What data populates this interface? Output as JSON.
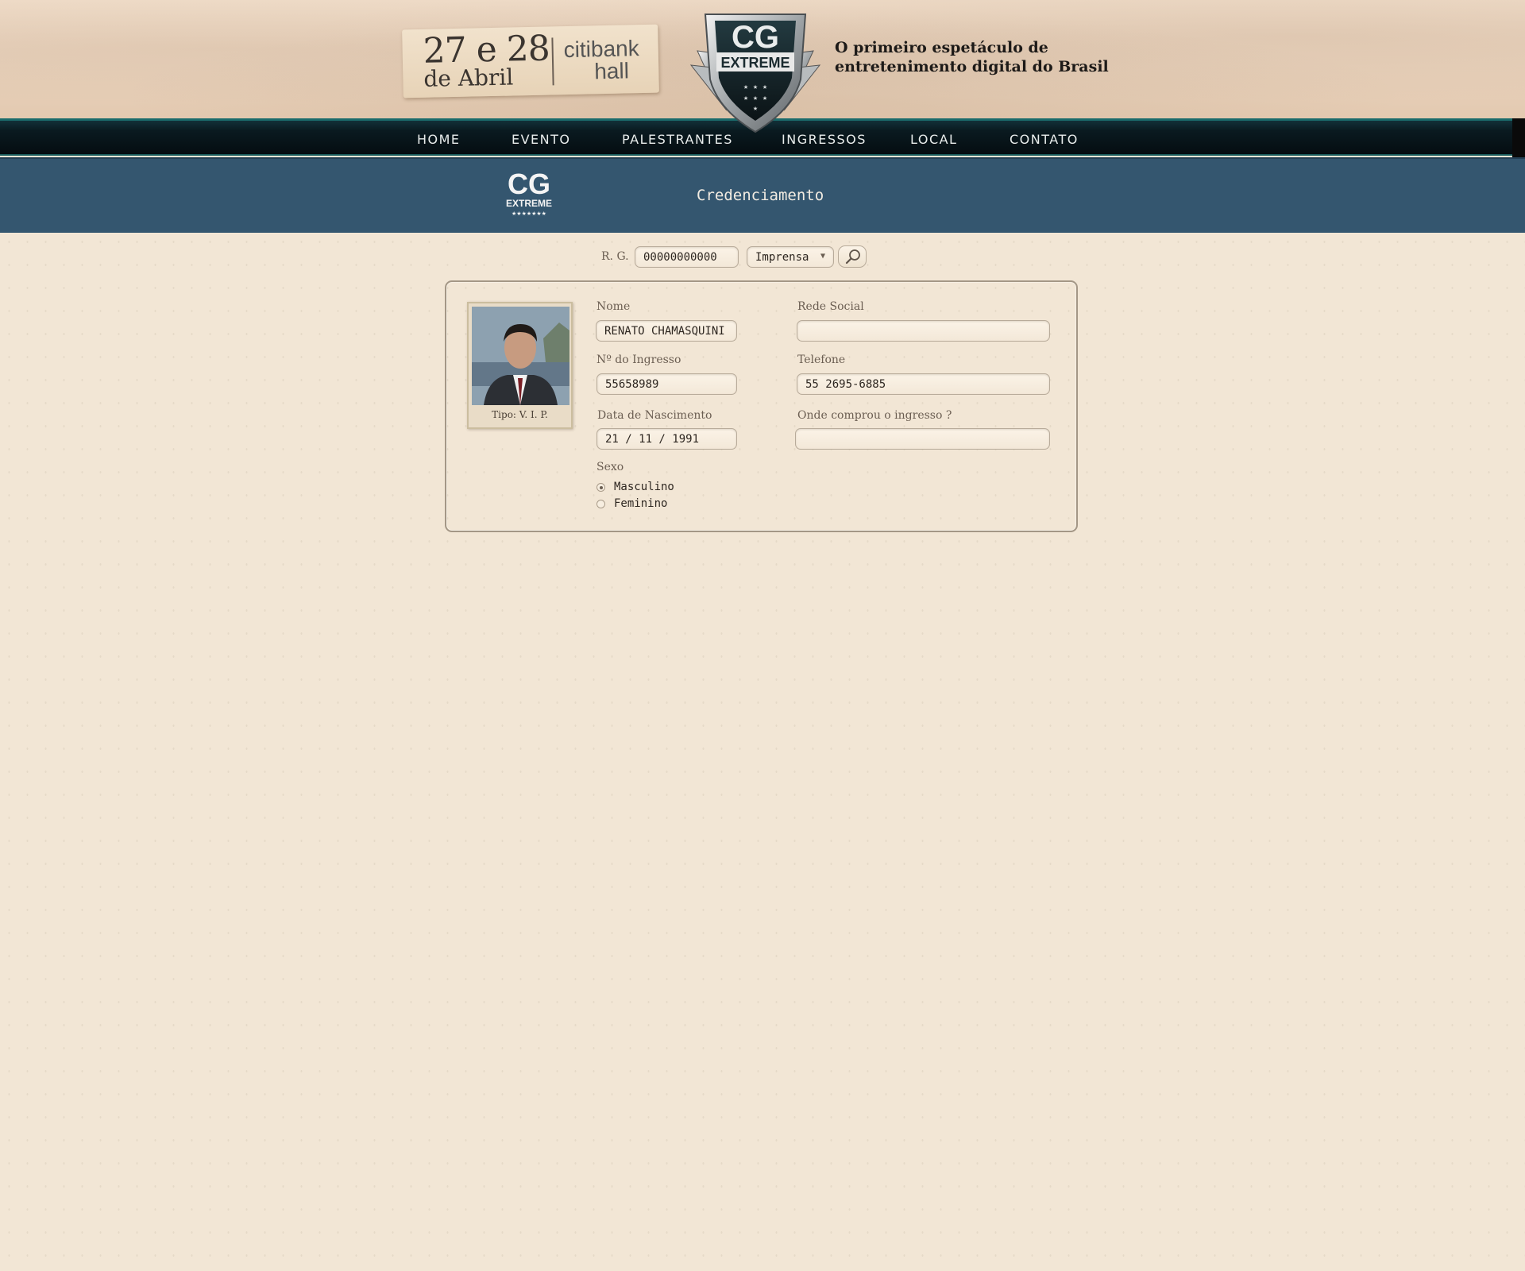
{
  "header": {
    "date_days": "27 e 28",
    "date_month": "de Abril",
    "venue_line1": "citibank",
    "venue_line2": "hall",
    "logo_text_main": "CG",
    "logo_text_sub": "EXTREME",
    "tagline_line1": "O primeiro espetáculo de",
    "tagline_line2": "entretenimento digital do Brasil"
  },
  "nav": {
    "items": [
      {
        "label": "HOME"
      },
      {
        "label": "EVENTO"
      },
      {
        "label": "PALESTRANTES"
      },
      {
        "label": "INGRESSOS"
      },
      {
        "label": "LOCAL"
      },
      {
        "label": "CONTATO"
      }
    ]
  },
  "band": {
    "logo_main": "CG",
    "logo_sub": "EXTREME",
    "logo_stars": "★★★★★★★",
    "title": "Credenciamento"
  },
  "search": {
    "rg_label": "R. G.",
    "rg_value": "00000000000",
    "category_selected": "Imprensa",
    "search_icon": "magnifier-icon"
  },
  "card": {
    "photo_caption": "Tipo: V. I. P.",
    "nome_label": "Nome",
    "nome_value": "RENATO CHAMASQUINI",
    "ingresso_label": "Nº do Ingresso",
    "ingresso_value": "55658989",
    "nascimento_label": "Data de Nascimento",
    "nascimento_value": "21 / 11 / 1991",
    "sexo_label": "Sexo",
    "sexo_options": [
      {
        "label": "Masculino",
        "checked": true
      },
      {
        "label": "Feminino",
        "checked": false
      }
    ],
    "rede_label": "Rede Social",
    "rede_value": "",
    "telefone_label": "Telefone",
    "telefone_value": "55 2695-6885",
    "onde_label": "Onde comprou o ingresso ?",
    "onde_value": ""
  },
  "colors": {
    "page_bg": "#f2e6d5",
    "nav_bg": "#050d11",
    "nav_accent": "#1a6b6b",
    "band_bg": "#34566f",
    "text_dark": "#2d2620"
  }
}
